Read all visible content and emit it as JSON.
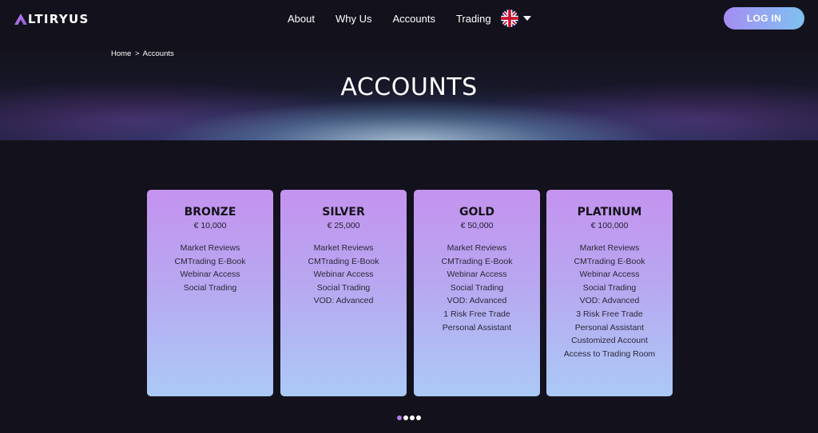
{
  "brand": {
    "name": "LTIRYUS",
    "accent": "#a06ce6"
  },
  "nav": {
    "items": [
      {
        "label": "About"
      },
      {
        "label": "Why Us"
      },
      {
        "label": "Accounts"
      },
      {
        "label": "Trading"
      }
    ],
    "language_icon": "uk-flag-icon",
    "login_label": "LOG IN"
  },
  "breadcrumb": {
    "home": "Home",
    "separator": ">",
    "current": "Accounts"
  },
  "page_title": "ACCOUNTS",
  "accounts": [
    {
      "name": "BRONZE",
      "price": "€ 10,000",
      "features": [
        "Market Reviews",
        "CMTrading E-Book",
        "Webinar Access",
        "Social Trading"
      ]
    },
    {
      "name": "SILVER",
      "price": "€ 25,000",
      "features": [
        "Market Reviews",
        "CMTrading E-Book",
        "Webinar Access",
        "Social Trading",
        "VOD: Advanced"
      ]
    },
    {
      "name": "GOLD",
      "price": "€ 50,000",
      "features": [
        "Market Reviews",
        "CMTrading E-Book",
        "Webinar Access",
        "Social Trading",
        "VOD: Advanced",
        "1 Risk Free Trade",
        "Personal Assistant"
      ]
    },
    {
      "name": "PLATINUM",
      "price": "€ 100,000",
      "features": [
        "Market Reviews",
        "CMTrading E-Book",
        "Webinar Access",
        "Social Trading",
        "VOD: Advanced",
        "3 Risk Free Trade",
        "Personal Assistant",
        "Customized Account",
        "Access to Trading Room"
      ]
    }
  ],
  "pagination": {
    "count": 4,
    "active_index": 0,
    "active_color": "#b07be8"
  }
}
